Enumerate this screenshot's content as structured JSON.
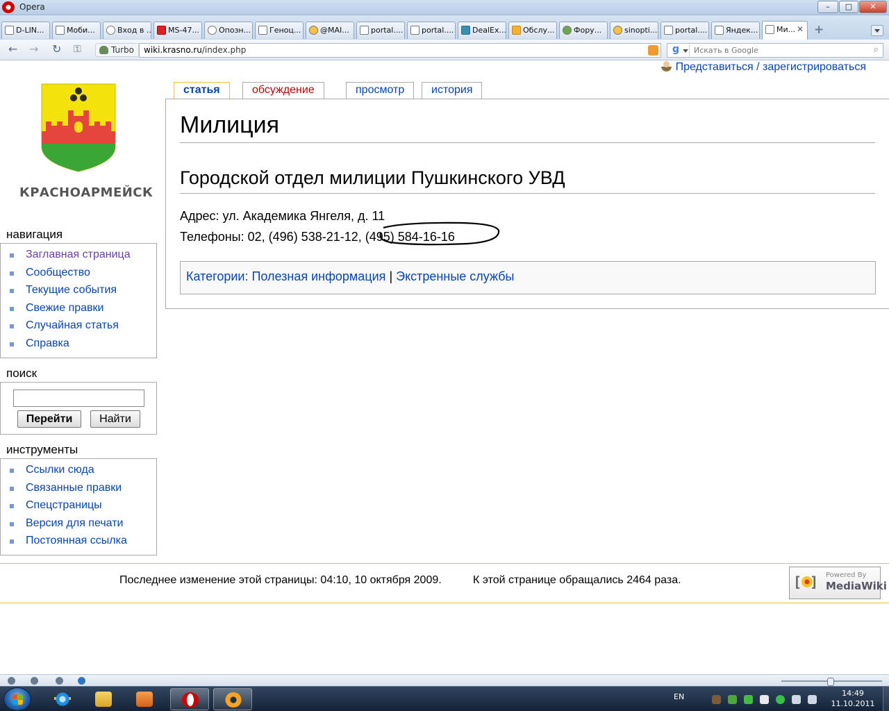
{
  "window": {
    "title": "Opera",
    "min": "–",
    "max": "□",
    "close": "✕"
  },
  "tabs": [
    {
      "label": "D-LIN..."
    },
    {
      "label": "Моби..."
    },
    {
      "label": "Вход в ..."
    },
    {
      "label": "MS-47..."
    },
    {
      "label": "Опозн..."
    },
    {
      "label": "Геноц..."
    },
    {
      "label": "@MAI..."
    },
    {
      "label": "portal...."
    },
    {
      "label": "portal...."
    },
    {
      "label": "DealEx..."
    },
    {
      "label": "Обслу..."
    },
    {
      "label": "Фору..."
    },
    {
      "label": "sinopti..."
    },
    {
      "label": "portal...."
    },
    {
      "label": "Яндек..."
    },
    {
      "label": "Ми...",
      "close": "✕"
    }
  ],
  "toolbar": {
    "turbo": "Turbo",
    "url_host": "wiki.krasno.ru",
    "url_path": "/index.php",
    "search_placeholder": "Искать в Google"
  },
  "page": {
    "personal_link": "Представиться / зарегистрироваться",
    "logo_text": "КРАСНОАРМЕЙСК",
    "content_tabs": {
      "article": "статья",
      "discussion": "обсуждение",
      "view": "просмотр",
      "history": "история"
    },
    "heading": "Милиция",
    "section_title": "Городской отдел милиции Пушкинского УВД",
    "address_label": "Адрес:",
    "address_value": "ул. Академика Янгеля, д. 11",
    "phones_label": "Телефоны:",
    "phones_value_1": "02, (496) 538-21-12,",
    "phones_value_2": "(495) 584-16-16",
    "categories_label": "Категории:",
    "category_1": "Полезная информация",
    "category_separator": "|",
    "category_2": "Экстренные службы"
  },
  "sidebar": {
    "navigation_title": "навигация",
    "navigation": [
      {
        "label": "Заглавная страница"
      },
      {
        "label": "Сообщество"
      },
      {
        "label": "Текущие события"
      },
      {
        "label": "Свежие правки"
      },
      {
        "label": "Случайная статья"
      },
      {
        "label": "Справка"
      }
    ],
    "search_title": "поиск",
    "search_go": "Перейти",
    "search_find": "Найти",
    "tools_title": "инструменты",
    "tools": [
      {
        "label": "Ссылки сюда"
      },
      {
        "label": "Связанные правки"
      },
      {
        "label": "Спецстраницы"
      },
      {
        "label": "Версия для печати"
      },
      {
        "label": "Постоянная ссылка"
      }
    ]
  },
  "footer": {
    "lastmod": "Последнее изменение этой страницы: 04:10, 10 октября 2009.",
    "viewcount": "К этой странице обращались 2464 раза.",
    "powered_small": "Powered By",
    "powered_big": "MediaWiki"
  },
  "taskbar": {
    "lang": "EN",
    "time": "14:49",
    "date": "11.10.2011"
  },
  "colors": {
    "link": "#0645ad",
    "new_link": "#ba0000",
    "selected_tab_border": "#fabd23",
    "footer_border": "#fabd23"
  }
}
